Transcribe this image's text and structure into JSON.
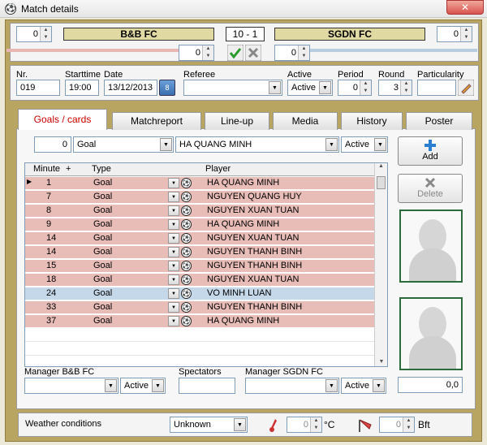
{
  "window": {
    "title": "Match details",
    "close": "✕"
  },
  "score": {
    "home_team": "B&B FC",
    "away_team": "SGDN FC",
    "result": "10 - 1",
    "home_spin": "0",
    "away_spin": "0",
    "home_sub": "0",
    "away_sub": "0"
  },
  "info": {
    "nr_label": "Nr.",
    "nr": "019",
    "start_label": "Starttime",
    "start": "19:00",
    "date_label": "Date",
    "date": "13/12/2013",
    "date_icon": "8",
    "referee_label": "Referee",
    "referee": "",
    "active_label": "Active",
    "active": "Active",
    "period_label": "Period",
    "period": "0",
    "round_label": "Round",
    "round": "3",
    "particularity_label": "Particularity",
    "particularity": ""
  },
  "tabs": [
    "Goals / cards",
    "Matchreport",
    "Line-up",
    "Media",
    "History",
    "Poster"
  ],
  "goals": {
    "filter_minute": "0",
    "filter_type": "Goal",
    "filter_player": "HA QUANG MINH",
    "filter_active": "Active",
    "columns": {
      "minute": "Minute",
      "plus": "+",
      "type": "Type",
      "player": "Player"
    },
    "rows": [
      {
        "minute": "1",
        "type": "Goal",
        "player": "HA QUANG MINH"
      },
      {
        "minute": "7",
        "type": "Goal",
        "player": "NGUYEN QUANG HUY"
      },
      {
        "minute": "8",
        "type": "Goal",
        "player": "NGUYEN XUAN TUAN"
      },
      {
        "minute": "9",
        "type": "Goal",
        "player": "HA QUANG MINH"
      },
      {
        "minute": "14",
        "type": "Goal",
        "player": "NGUYEN XUAN TUAN"
      },
      {
        "minute": "14",
        "type": "Goal",
        "player": "NGUYEN THANH BINH"
      },
      {
        "minute": "15",
        "type": "Goal",
        "player": "NGUYEN THANH BINH"
      },
      {
        "minute": "18",
        "type": "Goal",
        "player": "NGUYEN XUAN TUAN"
      },
      {
        "minute": "24",
        "type": "Goal",
        "player": "VO MINH LUAN"
      },
      {
        "minute": "33",
        "type": "Goal",
        "player": "NGUYEN THANH BINH"
      },
      {
        "minute": "37",
        "type": "Goal",
        "player": "HA QUANG MINH"
      }
    ],
    "add_label": "Add",
    "delete_label": "Delete"
  },
  "bottom": {
    "manager_home_label": "Manager B&B FC",
    "manager_home_active": "Active",
    "spectators_label": "Spectators",
    "manager_away_label": "Manager SGDN FC",
    "manager_away_active": "Active",
    "value": "0,0"
  },
  "weather": {
    "label": "Weather conditions",
    "condition": "Unknown",
    "temp": "0",
    "temp_unit": "°C",
    "wind": "0",
    "wind_unit": "Bft"
  },
  "colors": {
    "goal_row": "#e8bdb8",
    "selected_row": "#c4d8ea",
    "frame": "#b9a562",
    "tab_active_text": "#cc0000"
  }
}
